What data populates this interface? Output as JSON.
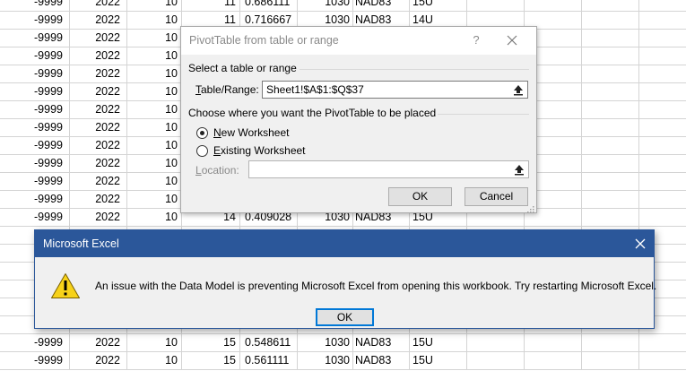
{
  "sheet": {
    "rows": [
      [
        "-9999",
        "2022",
        "10",
        "11",
        "0.686111",
        "1030",
        "NAD83",
        "15U"
      ],
      [
        "-9999",
        "2022",
        "10",
        "11",
        "0.716667",
        "1030",
        "NAD83",
        "14U"
      ],
      [
        "-9999",
        "2022",
        "10",
        "",
        "",
        "",
        "",
        ""
      ],
      [
        "-9999",
        "2022",
        "10",
        "",
        "",
        "",
        "",
        ""
      ],
      [
        "-9999",
        "2022",
        "10",
        "",
        "",
        "",
        "",
        ""
      ],
      [
        "-9999",
        "2022",
        "10",
        "",
        "",
        "",
        "",
        ""
      ],
      [
        "-9999",
        "2022",
        "10",
        "",
        "",
        "",
        "",
        ""
      ],
      [
        "-9999",
        "2022",
        "10",
        "",
        "",
        "",
        "",
        ""
      ],
      [
        "-9999",
        "2022",
        "10",
        "",
        "",
        "",
        "",
        ""
      ],
      [
        "-9999",
        "2022",
        "10",
        "",
        "",
        "",
        "",
        ""
      ],
      [
        "-9999",
        "2022",
        "10",
        "",
        "",
        "",
        "",
        ""
      ],
      [
        "-9999",
        "2022",
        "10",
        "",
        "",
        "",
        "",
        ""
      ],
      [
        "-9999",
        "2022",
        "10",
        "14",
        "0.409028",
        "1030",
        "NAD83",
        "15U"
      ],
      [
        "",
        "",
        "",
        "",
        "",
        "",
        "",
        ""
      ],
      [
        "",
        "",
        "",
        "",
        "",
        "",
        "",
        ""
      ],
      [
        "",
        "",
        "",
        "",
        "",
        "",
        "",
        ""
      ],
      [
        "",
        "",
        "",
        "",
        "",
        "",
        "",
        ""
      ],
      [
        "",
        "",
        "",
        "",
        "",
        "",
        "",
        ""
      ],
      [
        "",
        "",
        "",
        "",
        "",
        "",
        "",
        ""
      ],
      [
        "-9999",
        "2022",
        "10",
        "15",
        "0.548611",
        "1030",
        "NAD83",
        "15U"
      ],
      [
        "-9999",
        "2022",
        "10",
        "15",
        "0.561111",
        "1030",
        "NAD83",
        "15U"
      ]
    ]
  },
  "pivot_dialog": {
    "title": "PivotTable from table or range",
    "help_label": "?",
    "close_icon": "close-icon",
    "section_select": "Select a table or range",
    "table_range_label_mnemonic": "T",
    "table_range_label_rest": "able/Range:",
    "table_range_value": "Sheet1!$A$1:$Q$37",
    "section_place": "Choose where you want the PivotTable to be placed",
    "new_worksheet_mnemonic": "N",
    "new_worksheet_rest": "ew Worksheet",
    "existing_worksheet_mnemonic": "E",
    "existing_worksheet_rest": "xisting Worksheet",
    "location_label_mnemonic": "L",
    "location_label_rest": "ocation:",
    "location_value": "",
    "selected_option": "New Worksheet",
    "ok_label": "OK",
    "cancel_label": "Cancel",
    "collapse_icon": "collapse-range-icon"
  },
  "error_dialog": {
    "title": "Microsoft Excel",
    "icon": "warning-icon",
    "message": "An issue with the Data Model is preventing Microsoft Excel from opening this workbook. Try restarting Microsoft Excel.",
    "ok_label": "OK",
    "close_icon": "close-icon"
  },
  "colors": {
    "error_titlebar": "#2b579a",
    "dialog_background": "#f0f0f0",
    "focus_border": "#0078d7",
    "warning_yellow": "#f7d219",
    "grid_line": "#d4d4d4"
  }
}
